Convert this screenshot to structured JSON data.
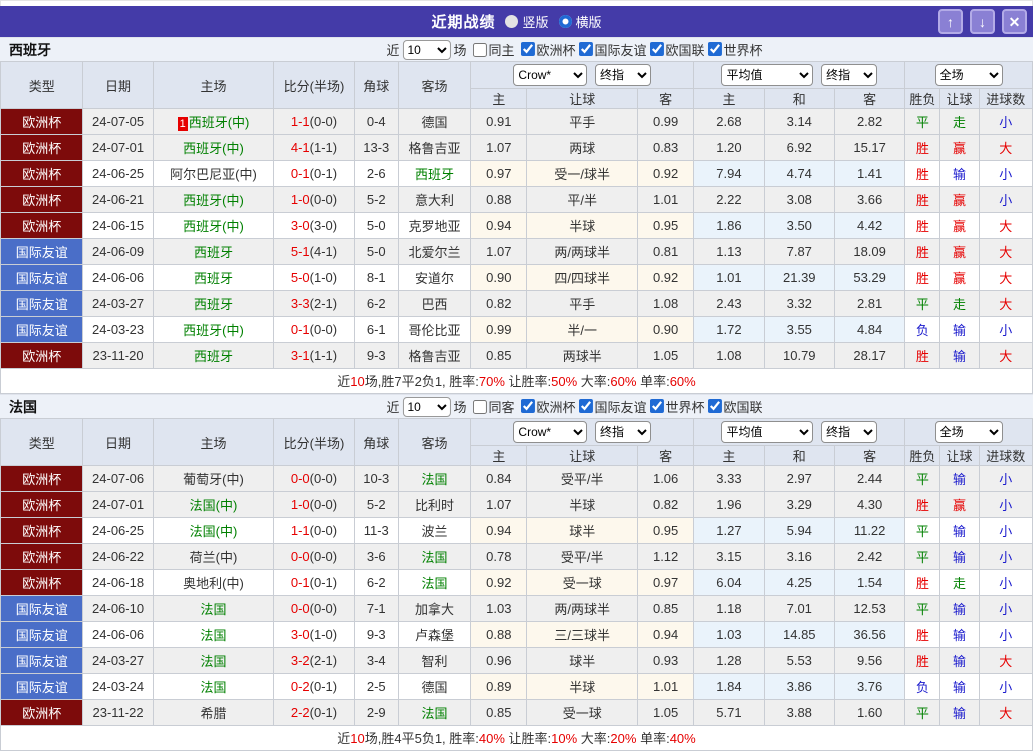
{
  "colors": {
    "titlebar_bg": "#443ba8",
    "titlebar_button_bg": "#8a80d4",
    "score_red": "#e60000",
    "team_green": "#008000",
    "crow_columns_bg": "#fdf8ed",
    "avg_columns_bg": "#eaf3fb",
    "shaded_row_bg": "#efefef",
    "header_bg": "#dfe5f0",
    "checkbox_blue": "#1f6ad4"
  },
  "league_colors": {
    "欧洲杯": "#7d0b0b",
    "国际友谊": "#4a6ec8"
  },
  "result_colors": {
    "r": "#e60000",
    "g": "#008000",
    "b": "#1a1acd"
  },
  "titlebar": {
    "title": "近期战绩",
    "radio_vertical": "竖版",
    "radio_horizontal": "横版",
    "selected_mode": "横版",
    "icons": {
      "up": "↑",
      "down": "↓",
      "close": "✕"
    }
  },
  "table_header": {
    "cols": [
      "类型",
      "日期",
      "主场",
      "比分(半场)",
      "角球",
      "客场"
    ],
    "crow_select": "Crow*",
    "crow_final_select": "终指",
    "crow_subcols": [
      "主",
      "让球",
      "客"
    ],
    "avg_select": "平均值",
    "avg_final_select": "终指",
    "avg_subcols": [
      "主",
      "和",
      "客"
    ],
    "fulltime_select": "全场",
    "result_subcols": [
      "胜负",
      "让球",
      "进球数"
    ]
  },
  "sections": [
    {
      "team": "西班牙",
      "filter": {
        "near_label": "近",
        "games_value": "10",
        "games_suffix": "场",
        "same_label": "同主",
        "same_checked": false,
        "leagues": [
          "欧洲杯",
          "国际友谊",
          "欧国联",
          "世界杯"
        ],
        "leagues_checked": true
      },
      "rows": [
        {
          "league": "欧洲杯",
          "date": "24-07-05",
          "badge": "1",
          "home": "西班牙(中)",
          "home_green": true,
          "score": "1-1",
          "half": "(0-0)",
          "corner": "0-4",
          "away": "德国",
          "away_green": false,
          "crow": [
            "0.91",
            "平手",
            "0.99"
          ],
          "avg": [
            "2.68",
            "3.14",
            "2.82"
          ],
          "result": [
            {
              "t": "平",
              "c": "g"
            },
            {
              "t": "走",
              "c": "g"
            },
            {
              "t": "小",
              "c": "b"
            }
          ]
        },
        {
          "league": "欧洲杯",
          "date": "24-07-01",
          "home": "西班牙(中)",
          "home_green": true,
          "score": "4-1",
          "half": "(1-1)",
          "corner": "13-3",
          "away": "格鲁吉亚",
          "away_green": false,
          "crow": [
            "1.07",
            "两球",
            "0.83"
          ],
          "avg": [
            "1.20",
            "6.92",
            "15.17"
          ],
          "result": [
            {
              "t": "胜",
              "c": "r"
            },
            {
              "t": "赢",
              "c": "r"
            },
            {
              "t": "大",
              "c": "r"
            }
          ]
        },
        {
          "league": "欧洲杯",
          "date": "24-06-25",
          "home": "阿尔巴尼亚(中)",
          "home_green": false,
          "score": "0-1",
          "half": "(0-1)",
          "corner": "2-6",
          "away": "西班牙",
          "away_green": true,
          "crow": [
            "0.97",
            "受一/球半",
            "0.92"
          ],
          "avg": [
            "7.94",
            "4.74",
            "1.41"
          ],
          "result": [
            {
              "t": "胜",
              "c": "r"
            },
            {
              "t": "输",
              "c": "b"
            },
            {
              "t": "小",
              "c": "b"
            }
          ]
        },
        {
          "league": "欧洲杯",
          "date": "24-06-21",
          "home": "西班牙(中)",
          "home_green": true,
          "score": "1-0",
          "half": "(0-0)",
          "corner": "5-2",
          "away": "意大利",
          "away_green": false,
          "crow": [
            "0.88",
            "平/半",
            "1.01"
          ],
          "avg": [
            "2.22",
            "3.08",
            "3.66"
          ],
          "result": [
            {
              "t": "胜",
              "c": "r"
            },
            {
              "t": "赢",
              "c": "r"
            },
            {
              "t": "小",
              "c": "b"
            }
          ]
        },
        {
          "league": "欧洲杯",
          "date": "24-06-15",
          "home": "西班牙(中)",
          "home_green": true,
          "score": "3-0",
          "half": "(3-0)",
          "corner": "5-0",
          "away": "克罗地亚",
          "away_green": false,
          "crow": [
            "0.94",
            "半球",
            "0.95"
          ],
          "avg": [
            "1.86",
            "3.50",
            "4.42"
          ],
          "result": [
            {
              "t": "胜",
              "c": "r"
            },
            {
              "t": "赢",
              "c": "r"
            },
            {
              "t": "大",
              "c": "r"
            }
          ]
        },
        {
          "league": "国际友谊",
          "date": "24-06-09",
          "home": "西班牙",
          "home_green": true,
          "score": "5-1",
          "half": "(4-1)",
          "corner": "5-0",
          "away": "北爱尔兰",
          "away_green": false,
          "crow": [
            "1.07",
            "两/两球半",
            "0.81"
          ],
          "avg": [
            "1.13",
            "7.87",
            "18.09"
          ],
          "result": [
            {
              "t": "胜",
              "c": "r"
            },
            {
              "t": "赢",
              "c": "r"
            },
            {
              "t": "大",
              "c": "r"
            }
          ]
        },
        {
          "league": "国际友谊",
          "date": "24-06-06",
          "home": "西班牙",
          "home_green": true,
          "score": "5-0",
          "half": "(1-0)",
          "corner": "8-1",
          "away": "安道尔",
          "away_green": false,
          "crow": [
            "0.90",
            "四/四球半",
            "0.92"
          ],
          "avg": [
            "1.01",
            "21.39",
            "53.29"
          ],
          "result": [
            {
              "t": "胜",
              "c": "r"
            },
            {
              "t": "赢",
              "c": "r"
            },
            {
              "t": "大",
              "c": "r"
            }
          ]
        },
        {
          "league": "国际友谊",
          "date": "24-03-27",
          "home": "西班牙",
          "home_green": true,
          "score": "3-3",
          "half": "(2-1)",
          "corner": "6-2",
          "away": "巴西",
          "away_green": false,
          "crow": [
            "0.82",
            "平手",
            "1.08"
          ],
          "avg": [
            "2.43",
            "3.32",
            "2.81"
          ],
          "result": [
            {
              "t": "平",
              "c": "g"
            },
            {
              "t": "走",
              "c": "g"
            },
            {
              "t": "大",
              "c": "r"
            }
          ]
        },
        {
          "league": "国际友谊",
          "date": "24-03-23",
          "home": "西班牙(中)",
          "home_green": true,
          "score": "0-1",
          "half": "(0-0)",
          "corner": "6-1",
          "away": "哥伦比亚",
          "away_green": false,
          "crow": [
            "0.99",
            "半/一",
            "0.90"
          ],
          "avg": [
            "1.72",
            "3.55",
            "4.84"
          ],
          "result": [
            {
              "t": "负",
              "c": "b"
            },
            {
              "t": "输",
              "c": "b"
            },
            {
              "t": "小",
              "c": "b"
            }
          ]
        },
        {
          "league": "欧洲杯",
          "date": "23-11-20",
          "home": "西班牙",
          "home_green": true,
          "score": "3-1",
          "half": "(1-1)",
          "corner": "9-3",
          "away": "格鲁吉亚",
          "away_green": false,
          "crow": [
            "0.85",
            "两球半",
            "1.05"
          ],
          "avg": [
            "1.08",
            "10.79",
            "28.17"
          ],
          "result": [
            {
              "t": "胜",
              "c": "r"
            },
            {
              "t": "输",
              "c": "b"
            },
            {
              "t": "大",
              "c": "r"
            }
          ]
        }
      ],
      "summary": [
        {
          "t": "近"
        },
        {
          "t": "10",
          "red": true
        },
        {
          "t": "场,胜7平2负1, 胜率:"
        },
        {
          "t": "70%",
          "red": true
        },
        {
          "t": " 让胜率:"
        },
        {
          "t": "50%",
          "red": true
        },
        {
          "t": " 大率:"
        },
        {
          "t": "60%",
          "red": true
        },
        {
          "t": " 单率:"
        },
        {
          "t": "60%",
          "red": true
        }
      ]
    },
    {
      "team": "法国",
      "filter": {
        "near_label": "近",
        "games_value": "10",
        "games_suffix": "场",
        "same_label": "同客",
        "same_checked": false,
        "leagues": [
          "欧洲杯",
          "国际友谊",
          "世界杯",
          "欧国联"
        ],
        "leagues_checked": true
      },
      "rows": [
        {
          "league": "欧洲杯",
          "date": "24-07-06",
          "home": "葡萄牙(中)",
          "home_green": false,
          "score": "0-0",
          "half": "(0-0)",
          "corner": "10-3",
          "away": "法国",
          "away_green": true,
          "crow": [
            "0.84",
            "受平/半",
            "1.06"
          ],
          "avg": [
            "3.33",
            "2.97",
            "2.44"
          ],
          "result": [
            {
              "t": "平",
              "c": "g"
            },
            {
              "t": "输",
              "c": "b"
            },
            {
              "t": "小",
              "c": "b"
            }
          ]
        },
        {
          "league": "欧洲杯",
          "date": "24-07-01",
          "home": "法国(中)",
          "home_green": true,
          "score": "1-0",
          "half": "(0-0)",
          "corner": "5-2",
          "away": "比利时",
          "away_green": false,
          "crow": [
            "1.07",
            "半球",
            "0.82"
          ],
          "avg": [
            "1.96",
            "3.29",
            "4.30"
          ],
          "result": [
            {
              "t": "胜",
              "c": "r"
            },
            {
              "t": "赢",
              "c": "r"
            },
            {
              "t": "小",
              "c": "b"
            }
          ]
        },
        {
          "league": "欧洲杯",
          "date": "24-06-25",
          "home": "法国(中)",
          "home_green": true,
          "score": "1-1",
          "half": "(0-0)",
          "corner": "11-3",
          "away": "波兰",
          "away_green": false,
          "crow": [
            "0.94",
            "球半",
            "0.95"
          ],
          "avg": [
            "1.27",
            "5.94",
            "11.22"
          ],
          "result": [
            {
              "t": "平",
              "c": "g"
            },
            {
              "t": "输",
              "c": "b"
            },
            {
              "t": "小",
              "c": "b"
            }
          ]
        },
        {
          "league": "欧洲杯",
          "date": "24-06-22",
          "home": "荷兰(中)",
          "home_green": false,
          "score": "0-0",
          "half": "(0-0)",
          "corner": "3-6",
          "away": "法国",
          "away_green": true,
          "crow": [
            "0.78",
            "受平/半",
            "1.12"
          ],
          "avg": [
            "3.15",
            "3.16",
            "2.42"
          ],
          "result": [
            {
              "t": "平",
              "c": "g"
            },
            {
              "t": "输",
              "c": "b"
            },
            {
              "t": "小",
              "c": "b"
            }
          ]
        },
        {
          "league": "欧洲杯",
          "date": "24-06-18",
          "home": "奥地利(中)",
          "home_green": false,
          "score": "0-1",
          "half": "(0-1)",
          "corner": "6-2",
          "away": "法国",
          "away_green": true,
          "crow": [
            "0.92",
            "受一球",
            "0.97"
          ],
          "avg": [
            "6.04",
            "4.25",
            "1.54"
          ],
          "result": [
            {
              "t": "胜",
              "c": "r"
            },
            {
              "t": "走",
              "c": "g"
            },
            {
              "t": "小",
              "c": "b"
            }
          ]
        },
        {
          "league": "国际友谊",
          "date": "24-06-10",
          "home": "法国",
          "home_green": true,
          "score": "0-0",
          "half": "(0-0)",
          "corner": "7-1",
          "away": "加拿大",
          "away_green": false,
          "crow": [
            "1.03",
            "两/两球半",
            "0.85"
          ],
          "avg": [
            "1.18",
            "7.01",
            "12.53"
          ],
          "result": [
            {
              "t": "平",
              "c": "g"
            },
            {
              "t": "输",
              "c": "b"
            },
            {
              "t": "小",
              "c": "b"
            }
          ]
        },
        {
          "league": "国际友谊",
          "date": "24-06-06",
          "home": "法国",
          "home_green": true,
          "score": "3-0",
          "half": "(1-0)",
          "corner": "9-3",
          "away": "卢森堡",
          "away_green": false,
          "crow": [
            "0.88",
            "三/三球半",
            "0.94"
          ],
          "avg": [
            "1.03",
            "14.85",
            "36.56"
          ],
          "result": [
            {
              "t": "胜",
              "c": "r"
            },
            {
              "t": "输",
              "c": "b"
            },
            {
              "t": "小",
              "c": "b"
            }
          ]
        },
        {
          "league": "国际友谊",
          "date": "24-03-27",
          "home": "法国",
          "home_green": true,
          "score": "3-2",
          "half": "(2-1)",
          "corner": "3-4",
          "away": "智利",
          "away_green": false,
          "crow": [
            "0.96",
            "球半",
            "0.93"
          ],
          "avg": [
            "1.28",
            "5.53",
            "9.56"
          ],
          "result": [
            {
              "t": "胜",
              "c": "r"
            },
            {
              "t": "输",
              "c": "b"
            },
            {
              "t": "大",
              "c": "r"
            }
          ]
        },
        {
          "league": "国际友谊",
          "date": "24-03-24",
          "home": "法国",
          "home_green": true,
          "score": "0-2",
          "half": "(0-1)",
          "corner": "2-5",
          "away": "德国",
          "away_green": false,
          "crow": [
            "0.89",
            "半球",
            "1.01"
          ],
          "avg": [
            "1.84",
            "3.86",
            "3.76"
          ],
          "result": [
            {
              "t": "负",
              "c": "b"
            },
            {
              "t": "输",
              "c": "b"
            },
            {
              "t": "小",
              "c": "b"
            }
          ]
        },
        {
          "league": "欧洲杯",
          "date": "23-11-22",
          "home": "希腊",
          "home_green": false,
          "score": "2-2",
          "half": "(0-1)",
          "corner": "2-9",
          "away": "法国",
          "away_green": true,
          "crow": [
            "0.85",
            "受一球",
            "1.05"
          ],
          "avg": [
            "5.71",
            "3.88",
            "1.60"
          ],
          "result": [
            {
              "t": "平",
              "c": "g"
            },
            {
              "t": "输",
              "c": "b"
            },
            {
              "t": "大",
              "c": "r"
            }
          ]
        }
      ],
      "summary": [
        {
          "t": "近"
        },
        {
          "t": "10",
          "red": true
        },
        {
          "t": "场,胜4平5负1, 胜率:"
        },
        {
          "t": "40%",
          "red": true
        },
        {
          "t": " 让胜率:"
        },
        {
          "t": "10%",
          "red": true
        },
        {
          "t": " 大率:"
        },
        {
          "t": "20%",
          "red": true
        },
        {
          "t": " 单率:"
        },
        {
          "t": "40%",
          "red": true
        }
      ]
    }
  ]
}
